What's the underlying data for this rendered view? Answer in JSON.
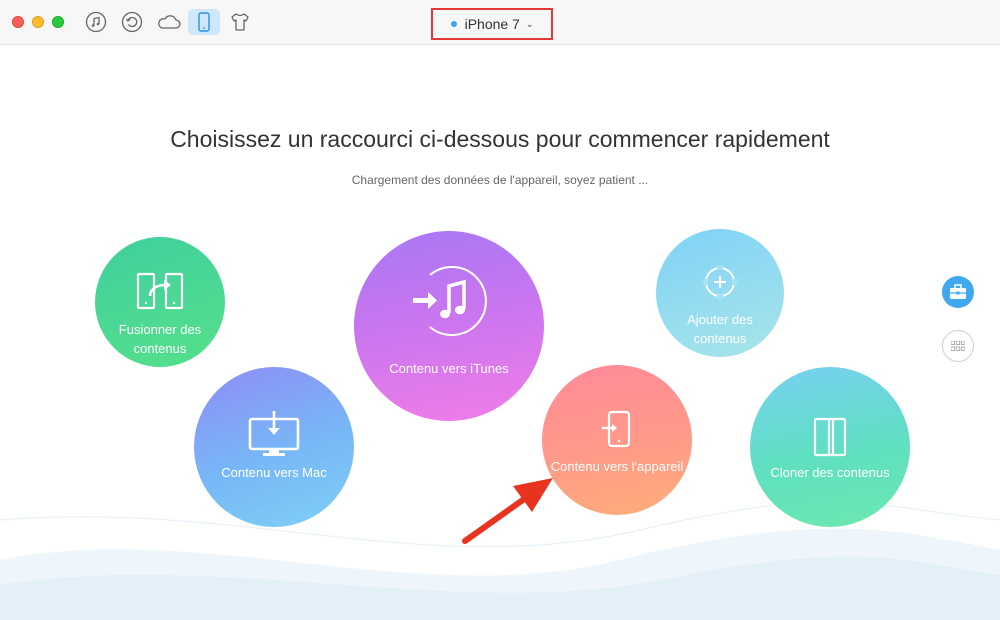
{
  "toolbar": {
    "icons": [
      "music-icon",
      "history-icon",
      "cloud-icon",
      "phone-icon",
      "shirt-icon"
    ],
    "active_icon": "phone-icon",
    "device": {
      "name": "iPhone 7",
      "status_color": "#3ba4f0"
    }
  },
  "main": {
    "headline": "Choisissez un raccourci ci-dessous pour commencer rapidement",
    "subline": "Chargement des données de l'appareil, soyez patient ..."
  },
  "shortcuts": {
    "merge": {
      "line1": "Fusionner des",
      "line2": "contenus",
      "icon": "merge-icon"
    },
    "mac": {
      "label": "Contenu vers Mac",
      "icon": "monitor-download-icon"
    },
    "itunes": {
      "label": "Contenu vers iTunes",
      "icon": "itunes-transfer-icon"
    },
    "add": {
      "line1": "Ajouter des",
      "line2": "contenus",
      "icon": "add-crosshair-icon"
    },
    "device": {
      "label": "Contenu vers l'appareil",
      "icon": "phone-import-icon"
    },
    "clone": {
      "label": "Cloner des contenus",
      "icon": "clone-phones-icon"
    }
  },
  "side": {
    "icons": [
      "toolbox-icon",
      "grid-icon"
    ]
  },
  "colors": {
    "accent": "#3fa8ee",
    "highlight": "#e53935"
  }
}
